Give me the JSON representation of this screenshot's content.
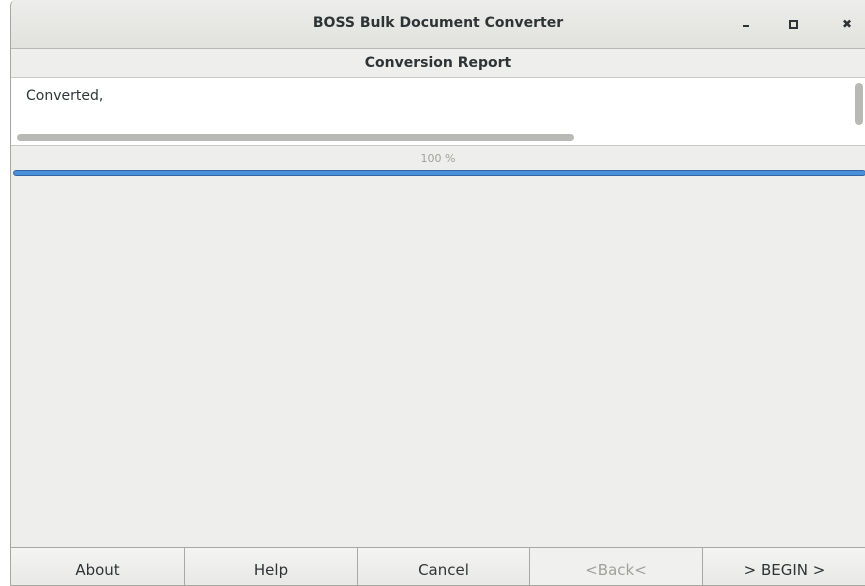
{
  "window": {
    "title": "BOSS Bulk Document Converter",
    "controls": {
      "minimize": "minimize-icon",
      "maximize": "maximize-icon",
      "close": "close-icon",
      "close_glyph": "✖"
    }
  },
  "report": {
    "header": "Conversion Report",
    "text": "Converted,"
  },
  "progress": {
    "label": "100 %",
    "value": 1.0,
    "fill_color": "#4a90d9"
  },
  "buttons": {
    "about": "About",
    "help": "Help",
    "cancel": "Cancel",
    "back": "<Back<",
    "begin": "> BEGIN >"
  }
}
